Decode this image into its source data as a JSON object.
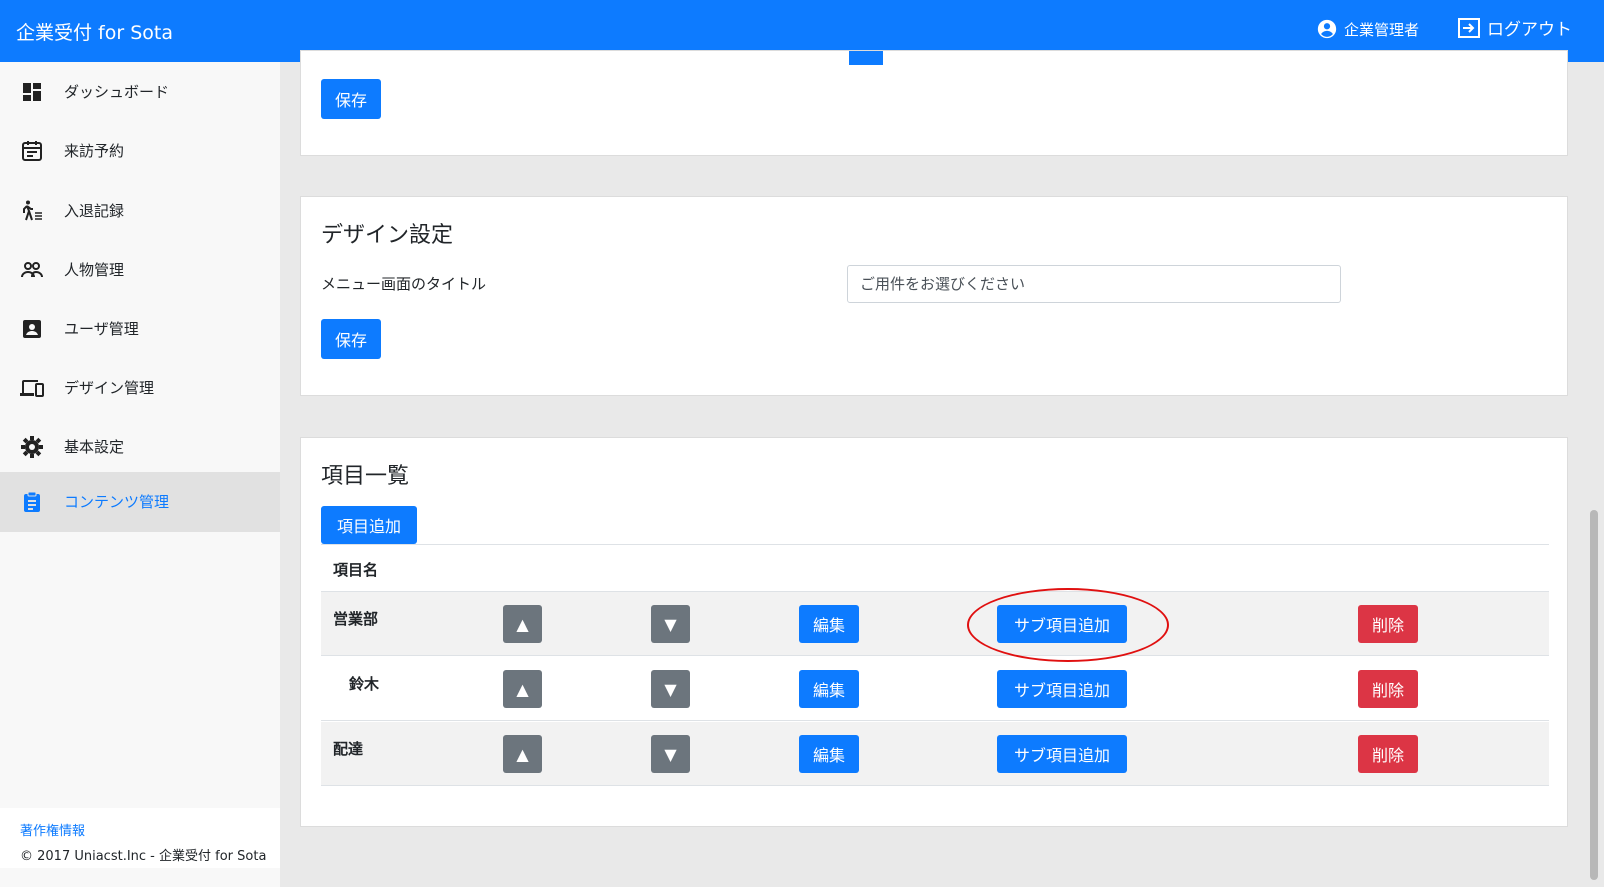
{
  "header": {
    "brand": "企業受付 for Sota",
    "user": "企業管理者",
    "logout": "ログアウト"
  },
  "sidebar": {
    "items": [
      {
        "label": "ダッシュボード",
        "icon": "dashboard-icon"
      },
      {
        "label": "来訪予約",
        "icon": "calendar-icon"
      },
      {
        "label": "入退記録",
        "icon": "walk-icon"
      },
      {
        "label": "人物管理",
        "icon": "people-icon"
      },
      {
        "label": "ユーザ管理",
        "icon": "account-box-icon"
      },
      {
        "label": "デザイン管理",
        "icon": "devices-icon"
      },
      {
        "label": "基本設定",
        "icon": "gear-icon"
      },
      {
        "label": "コンテンツ管理",
        "icon": "clipboard-icon"
      }
    ],
    "active_index": 7,
    "footer_link": "著作権情報",
    "copyright": "© 2017 Uniacst.Inc - 企業受付 for Sota"
  },
  "top_card": {
    "save": "保存"
  },
  "design_card": {
    "title": "デザイン設定",
    "menu_title_label": "メニュー画面のタイトル",
    "menu_title_placeholder": "ご用件をお選びください",
    "save": "保存"
  },
  "items_card": {
    "title": "項目一覧",
    "add": "項目追加",
    "column_name": "項目名",
    "rows": [
      {
        "name": "営業部",
        "indent": false,
        "up": "▲",
        "down": "▼",
        "edit": "編集",
        "add_sub": "サブ項目追加",
        "delete": "削除"
      },
      {
        "name": "鈴木",
        "indent": true,
        "up": "▲",
        "down": "▼",
        "edit": "編集",
        "add_sub": "サブ項目追加",
        "delete": "削除"
      },
      {
        "name": "配達",
        "indent": false,
        "up": "▲",
        "down": "▼",
        "edit": "編集",
        "add_sub": "サブ項目追加",
        "delete": "削除"
      }
    ]
  },
  "colors": {
    "primary": "#0d7bff",
    "secondary": "#6c757d",
    "danger": "#dc3545",
    "highlight": "#e01010"
  }
}
